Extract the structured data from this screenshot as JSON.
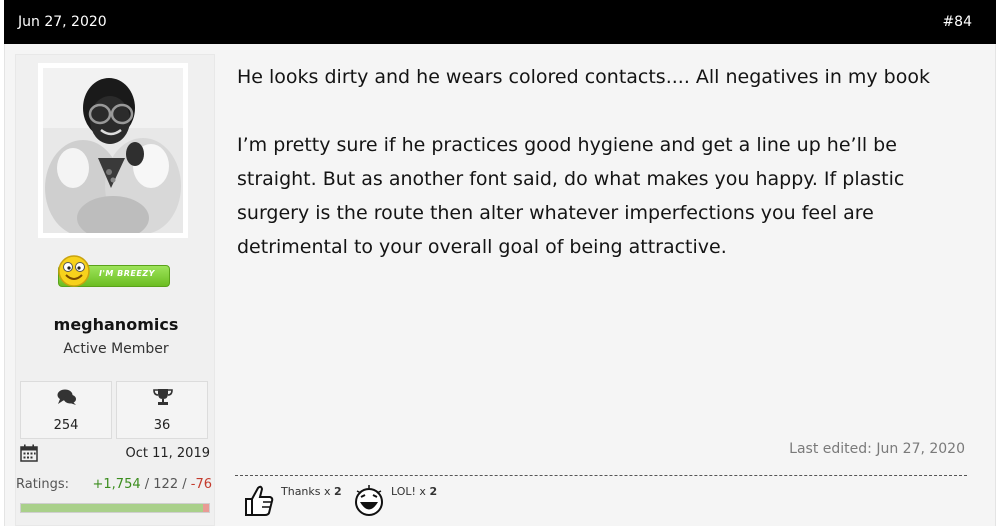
{
  "post": {
    "date": "Jun 27, 2020",
    "number": "#84"
  },
  "user": {
    "name": "meghanomics",
    "title": "Active Member",
    "banner_text": "I'M BREEZY",
    "messages_count": "254",
    "trophies_count": "36",
    "joined": "Oct 11, 2019",
    "ratings_label": "Ratings:",
    "ratings_positive": "+1,754",
    "ratings_sep1": " / ",
    "ratings_neutral": "122",
    "ratings_sep2": " / ",
    "ratings_negative": "-76"
  },
  "message": {
    "paragraph1": "He looks dirty and he wears colored contacts.... All negatives in my book",
    "paragraph2": "I’m pretty sure if he practices good hygiene and get a line up he’ll be straight. But as another font said, do what makes you happy. If plastic surgery is the route then alter whatever imperfections you feel are detrimental to your overall goal of being attractive.",
    "last_edited": "Last edited: Jun 27, 2020"
  },
  "reactions": [
    {
      "icon": "thumbs-up-icon",
      "label": "Thanks",
      "times": " x ",
      "count": "2"
    },
    {
      "icon": "laughing-face-icon",
      "label": "LOL!",
      "times": " x ",
      "count": "2"
    }
  ],
  "colors": {
    "header_bg": "#000000",
    "positive": "#3b8d1e",
    "negative": "#c43b2d",
    "banner_green": "#6cbd22"
  }
}
